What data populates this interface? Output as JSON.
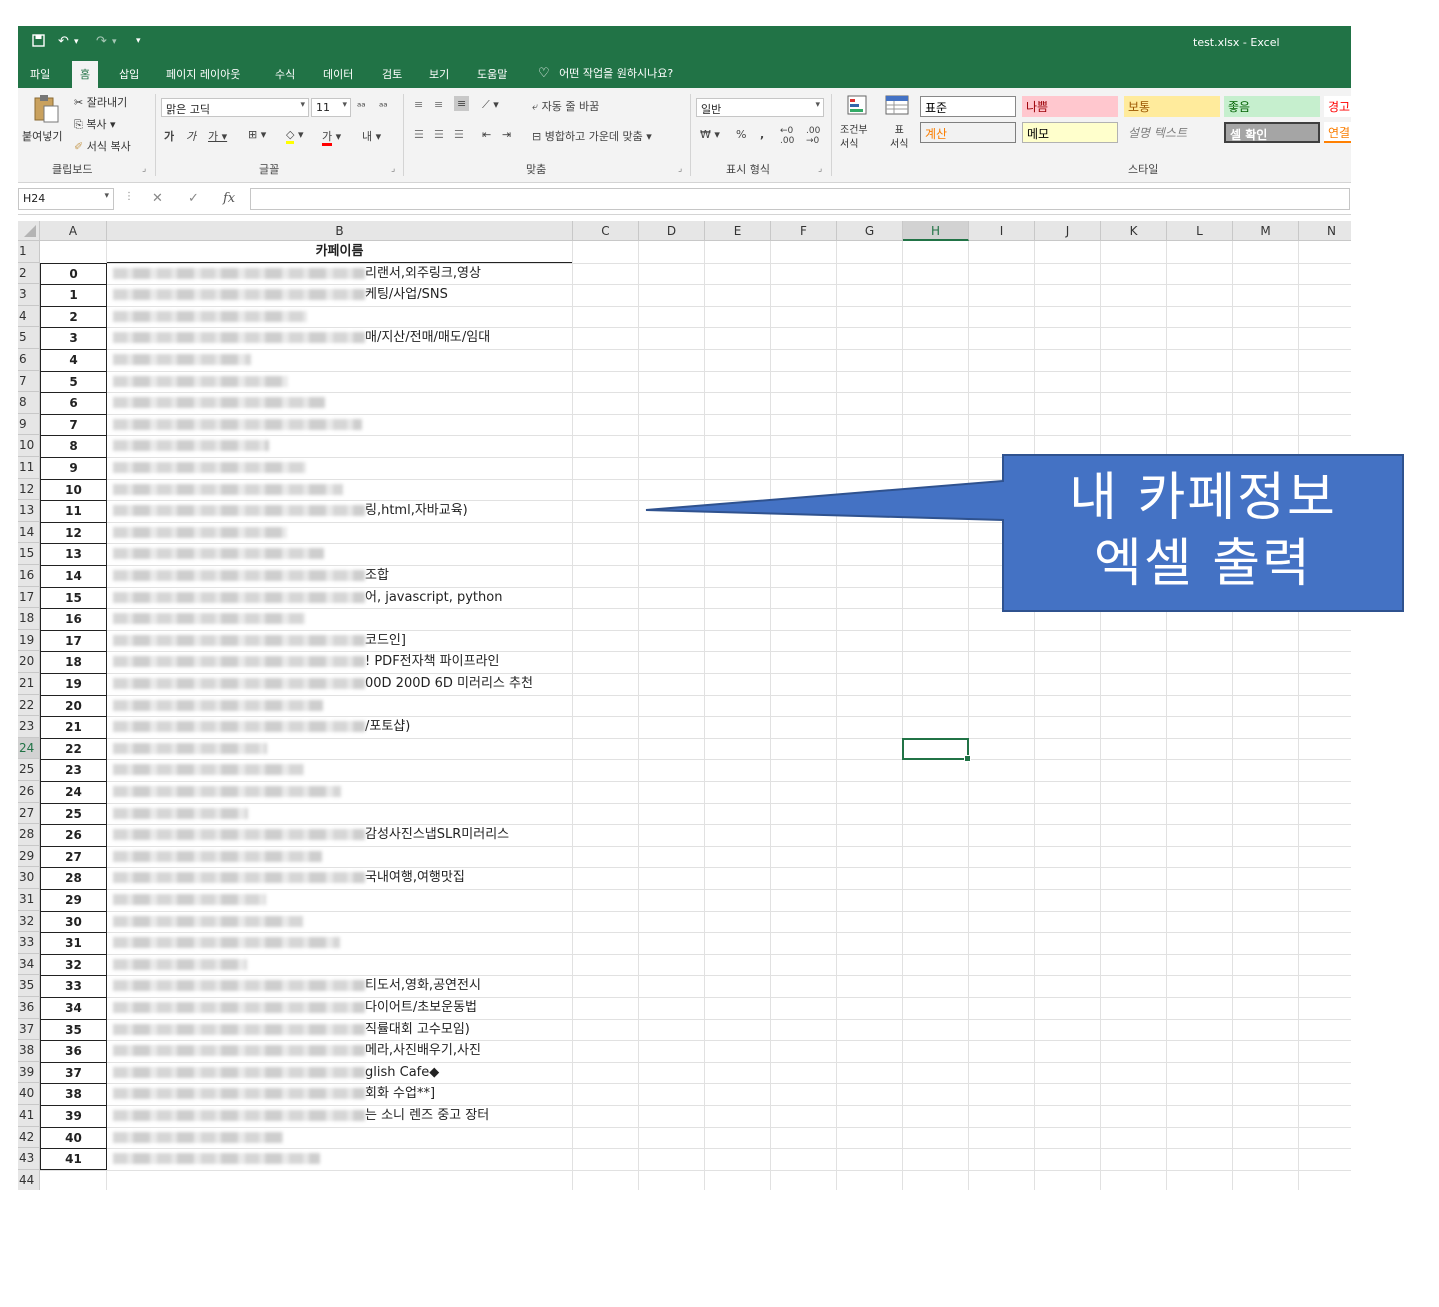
{
  "title_bar": {
    "window_title": "test.xlsx  -  Excel",
    "save_icon": "save-icon",
    "undo_icon": "undo-icon",
    "redo_icon": "redo-icon",
    "customize_icon": "customize-qat-icon"
  },
  "ribbon_tabs": [
    "파일",
    "홈",
    "삽입",
    "페이지 레이아웃",
    "수식",
    "데이터",
    "검토",
    "보기",
    "도움말"
  ],
  "active_tab": "홈",
  "tell_me": "어떤 작업을 원하시나요?",
  "clipboard": {
    "paste": "붙여넣기",
    "cut": "잘라내기",
    "copy": "복사",
    "format_painter": "서식 복사",
    "group": "클립보드"
  },
  "font": {
    "name": "맑은 고딕",
    "size": "11",
    "group": "글꼴"
  },
  "alignment": {
    "wrap": "자동 줄 바꿈",
    "merge": "병합하고 가운데 맞춤",
    "group": "맞춤"
  },
  "number": {
    "format": "일반",
    "group": "표시 형식"
  },
  "styles": {
    "conditional": "조건부\n서식",
    "table": "표\n서식",
    "group": "스타일",
    "cells": [
      {
        "label": "표준",
        "bg": "#ffffff",
        "fg": "#000000"
      },
      {
        "label": "나쁨",
        "bg": "#ffc7ce",
        "fg": "#9c0006"
      },
      {
        "label": "보통",
        "bg": "#ffeb9c",
        "fg": "#9c5700"
      },
      {
        "label": "좋음",
        "bg": "#c6efce",
        "fg": "#006100"
      },
      {
        "label": "경고",
        "bg": "#ffffff",
        "fg": "#ff0000"
      },
      {
        "label": "계산",
        "bg": "#f2f2f2",
        "fg": "#fa7d00"
      },
      {
        "label": "메모",
        "bg": "#ffffcc",
        "fg": "#000000"
      },
      {
        "label": "설명 텍스트",
        "bg": "#f3f3f3",
        "fg": "#7f7f7f"
      },
      {
        "label": "셀 확인",
        "bg": "#a5a5a5",
        "fg": "#ffffff"
      },
      {
        "label": "연결",
        "bg": "#ffffff",
        "fg": "#fa7d00"
      }
    ]
  },
  "formula_bar": {
    "name_box": "H24",
    "fx": "fx"
  },
  "columns": [
    "A",
    "B",
    "C",
    "D",
    "E",
    "F",
    "G",
    "H",
    "I",
    "J",
    "K",
    "L",
    "M",
    "N"
  ],
  "selected_column": "H",
  "selected_row": "24",
  "header_cell": "카페이름",
  "rows": [
    {
      "n": "0",
      "t": "리랜서,외주링크,영상"
    },
    {
      "n": "1",
      "t": "케팅/사업/SNS"
    },
    {
      "n": "2",
      "t": ""
    },
    {
      "n": "3",
      "t": "매/지산/전매/매도/임대"
    },
    {
      "n": "4",
      "t": ""
    },
    {
      "n": "5",
      "t": ""
    },
    {
      "n": "6",
      "t": ""
    },
    {
      "n": "7",
      "t": ""
    },
    {
      "n": "8",
      "t": ""
    },
    {
      "n": "9",
      "t": ""
    },
    {
      "n": "10",
      "t": ""
    },
    {
      "n": "11",
      "t": "링,html,자바교육)"
    },
    {
      "n": "12",
      "t": ""
    },
    {
      "n": "13",
      "t": ""
    },
    {
      "n": "14",
      "t": "조합"
    },
    {
      "n": "15",
      "t": "어, javascript, python"
    },
    {
      "n": "16",
      "t": ""
    },
    {
      "n": "17",
      "t": "코드인]"
    },
    {
      "n": "18",
      "t": "! PDF전자책 파이프라인"
    },
    {
      "n": "19",
      "t": "00D 200D 6D 미러리스 추천"
    },
    {
      "n": "20",
      "t": ""
    },
    {
      "n": "21",
      "t": "/포토샵)"
    },
    {
      "n": "22",
      "t": ""
    },
    {
      "n": "23",
      "t": ""
    },
    {
      "n": "24",
      "t": ""
    },
    {
      "n": "25",
      "t": ""
    },
    {
      "n": "26",
      "t": "감성사진스냅SLR미러리스"
    },
    {
      "n": "27",
      "t": ""
    },
    {
      "n": "28",
      "t": "국내여행,여행맛집"
    },
    {
      "n": "29",
      "t": ""
    },
    {
      "n": "30",
      "t": ""
    },
    {
      "n": "31",
      "t": ""
    },
    {
      "n": "32",
      "t": ""
    },
    {
      "n": "33",
      "t": "티도서,영화,공연전시"
    },
    {
      "n": "34",
      "t": "다이어트/초보운동법"
    },
    {
      "n": "35",
      "t": "직률대회 고수모임)"
    },
    {
      "n": "36",
      "t": "메라,사진배우기,사진"
    },
    {
      "n": "37",
      "t": "glish Cafe◆"
    },
    {
      "n": "38",
      "t": "회화 수업**]"
    },
    {
      "n": "39",
      "t": "는 소니 렌즈 중고 장터"
    },
    {
      "n": "40",
      "t": ""
    },
    {
      "n": "41",
      "t": ""
    }
  ],
  "callout": {
    "line1": "내 카페정보",
    "line2": "엑셀 출력",
    "fill": "#4472c4",
    "stroke": "#2f528f"
  }
}
